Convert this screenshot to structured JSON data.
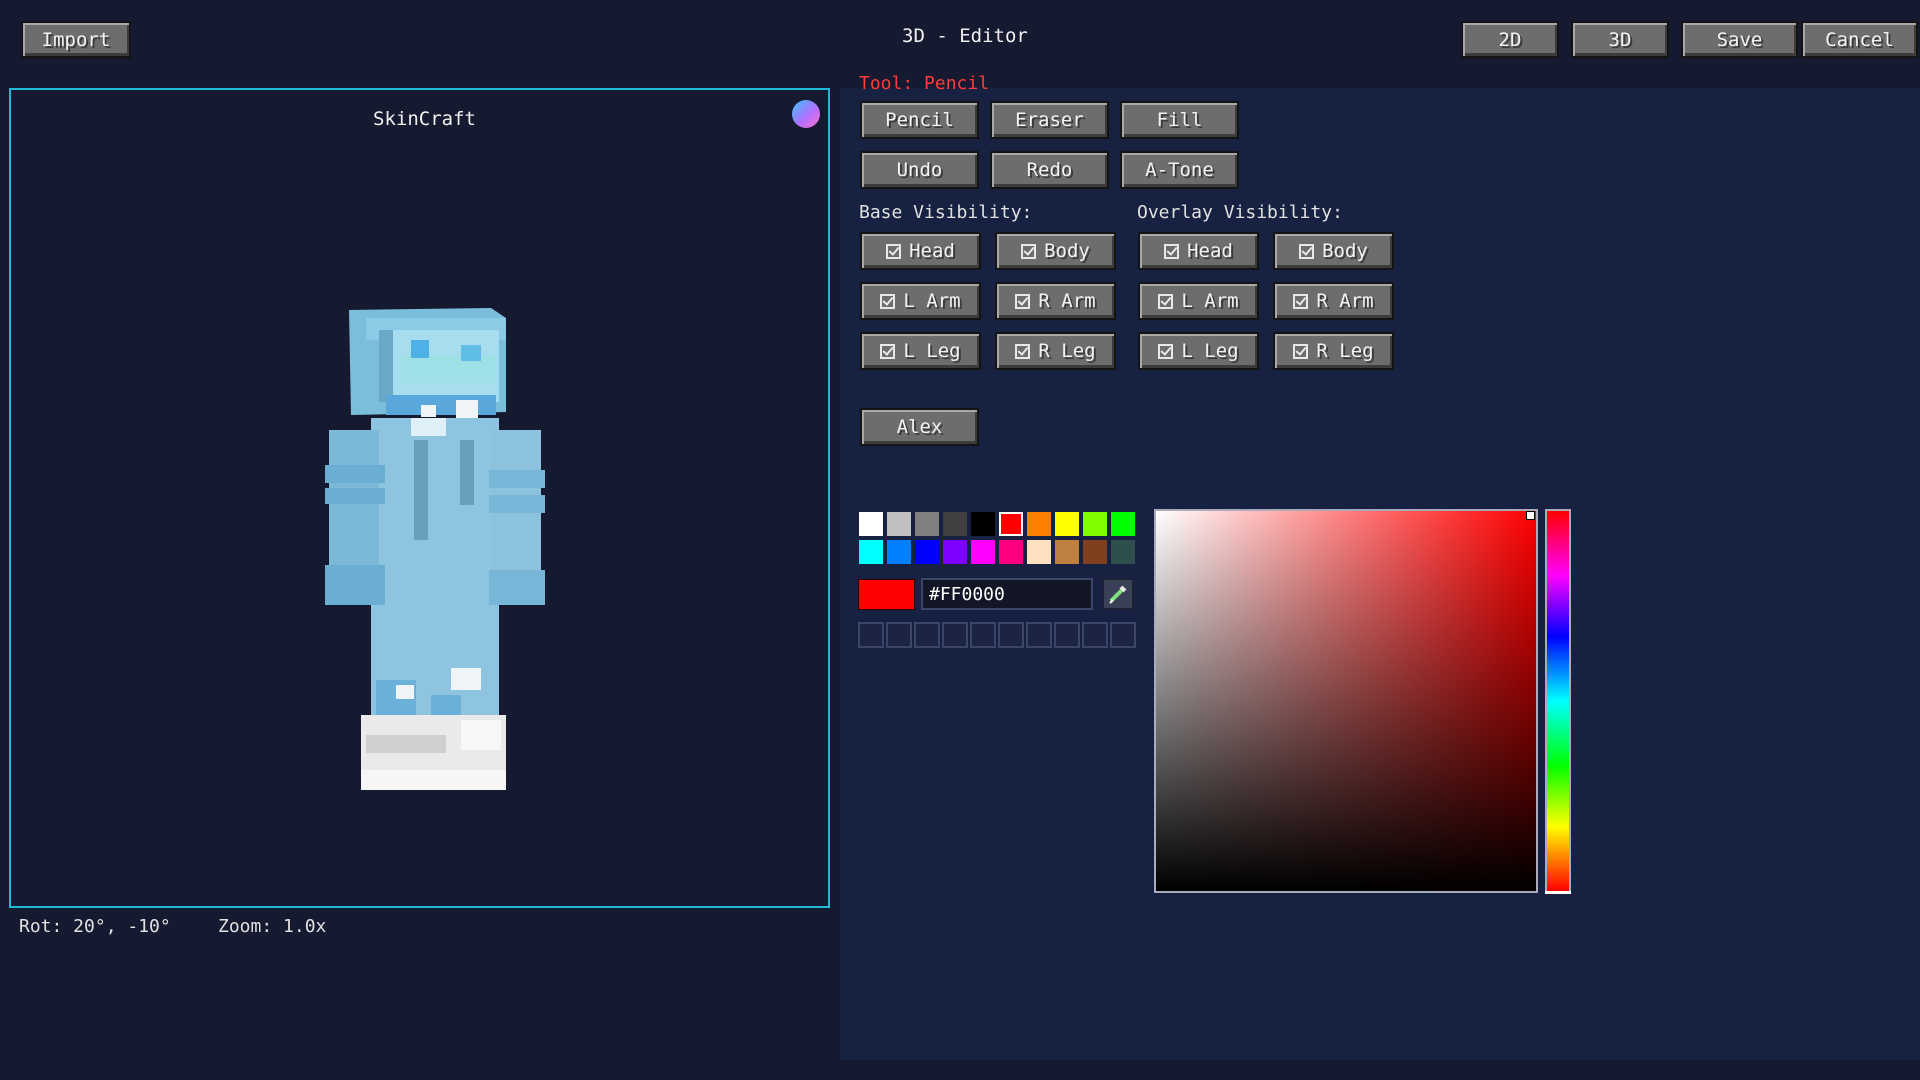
{
  "header": {
    "import_label": "Import",
    "title": "3D - Editor",
    "view_2d_label": "2D",
    "view_3d_label": "3D",
    "save_label": "Save",
    "cancel_label": "Cancel"
  },
  "viewport": {
    "title": "SkinCraft",
    "rotation": "Rot: 20°, -10°",
    "zoom": "Zoom: 1.0x",
    "border_color": "#22b8d8"
  },
  "tools": {
    "current_tool": "Tool: Pencil",
    "current_tool_color": "#ff3b3b",
    "buttons": [
      "Pencil",
      "Eraser",
      "Fill",
      "Undo",
      "Redo",
      "A-Tone"
    ]
  },
  "visibility": {
    "base_title": "Base Visibility:",
    "overlay_title": "Overlay Visibility:",
    "base": [
      "Head",
      "Body",
      "L Arm",
      "R Arm",
      "L Leg",
      "R Leg"
    ],
    "overlay": [
      "Head",
      "Body",
      "L Arm",
      "R Arm",
      "L Leg",
      "R Leg"
    ]
  },
  "model_button": "Alex",
  "palette": {
    "row1": [
      "#ffffff",
      "#c0c0c0",
      "#808080",
      "#404040",
      "#000000",
      "#ff0000",
      "#ff8000",
      "#ffff00",
      "#80ff00",
      "#00ff00"
    ],
    "row2": [
      "#00ffff",
      "#0080ff",
      "#0000ff",
      "#8000ff",
      "#ff00ff",
      "#ff0080",
      "#ffe0c0",
      "#c08040",
      "#804020",
      "#2f4f4f"
    ],
    "selected": "#ff0000",
    "hex_value": "#FF0000"
  },
  "icons": {
    "eyedropper": "eyedropper-icon",
    "corner_orb": "orb-icon",
    "checkbox": "checkbox-checked-icon"
  }
}
